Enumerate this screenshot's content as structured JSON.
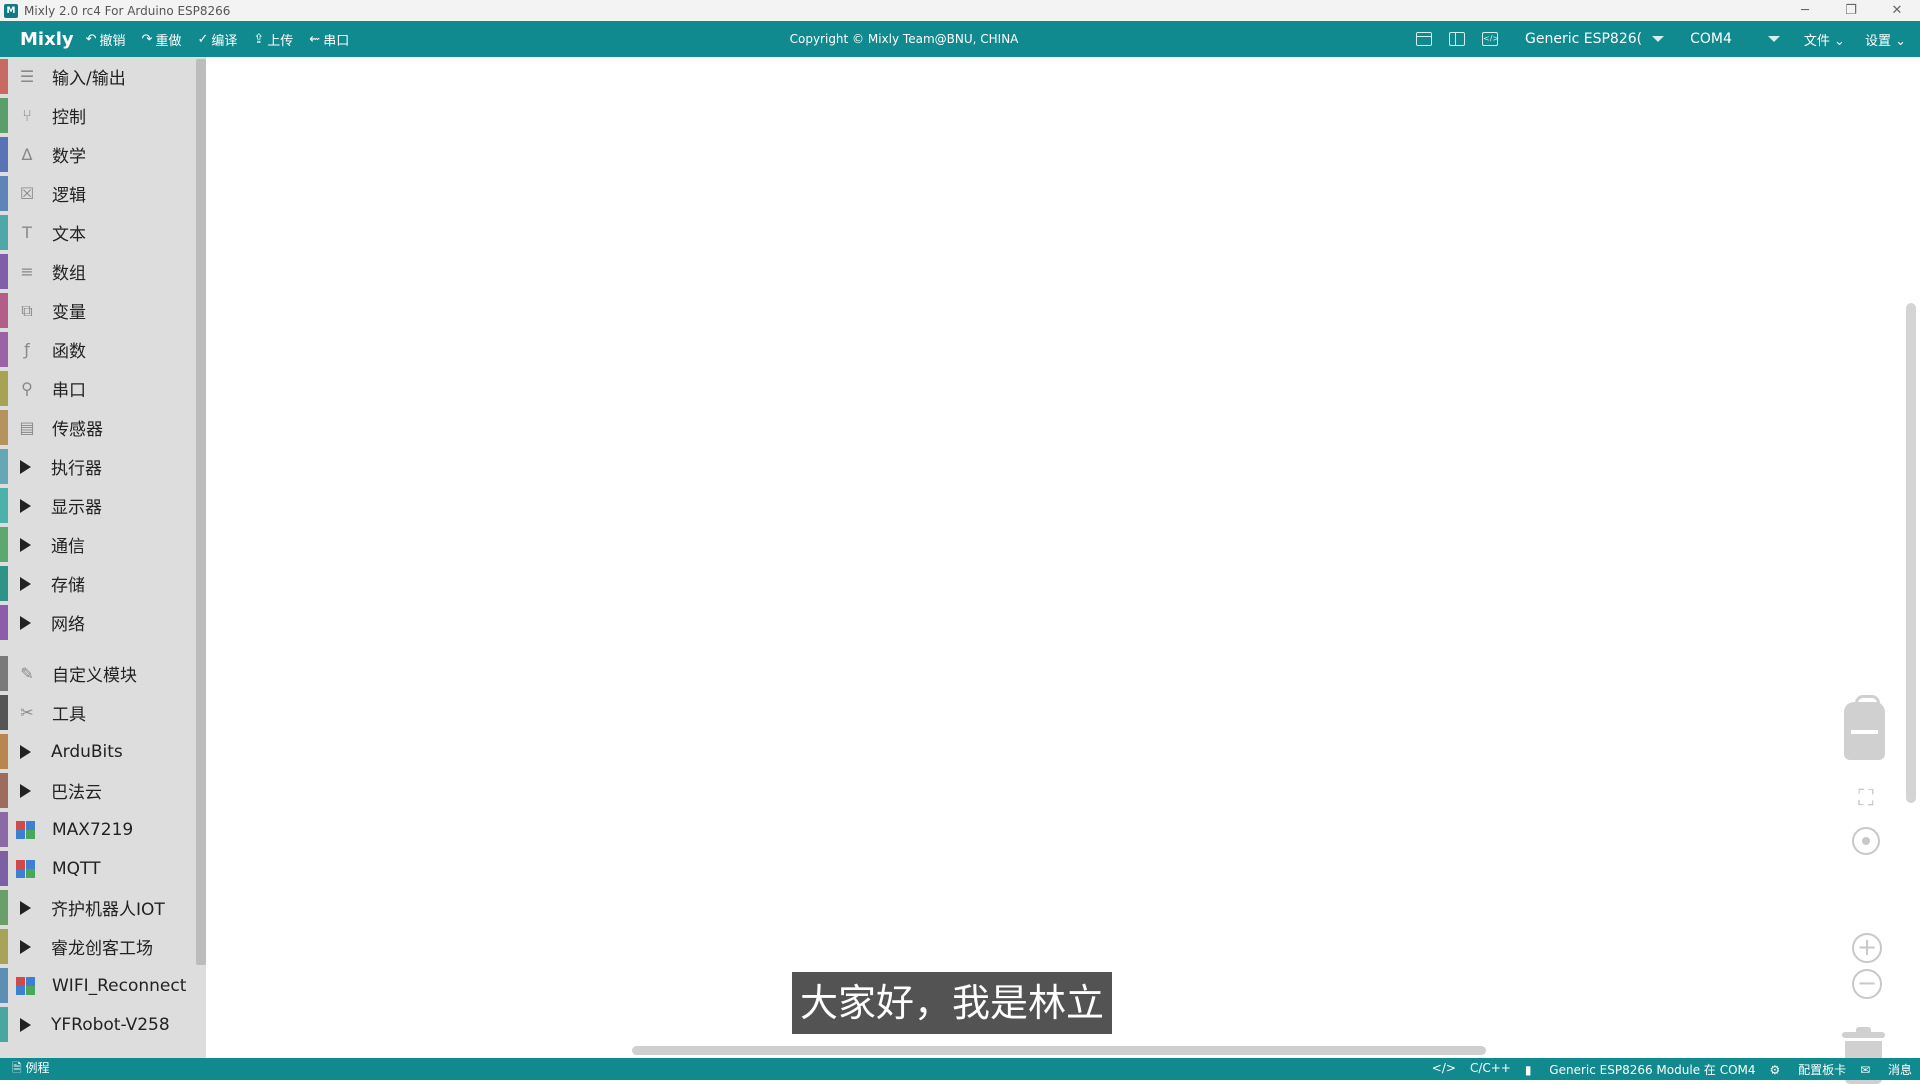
{
  "window": {
    "title": "Mixly 2.0 rc4 For Arduino ESP8266",
    "app_icon_text": "M",
    "minimize": "─",
    "restore": "❐",
    "close": "✕"
  },
  "toolbar": {
    "brand": "Mixly",
    "undo": "撤销",
    "redo": "重做",
    "compile": "编译",
    "upload": "上传",
    "serial": "串口",
    "copyright": "Copyright © Mixly Team@BNU, CHINA",
    "board": "Generic ESP826(",
    "port": "COM4",
    "file_menu": "文件",
    "settings_menu": "设置"
  },
  "sidebar": {
    "categories": [
      {
        "label": "输入/输出",
        "color": "#c76b62",
        "icon": "☰",
        "kind": "icon"
      },
      {
        "label": "控制",
        "color": "#5c9e6b",
        "icon": "⑂",
        "kind": "icon"
      },
      {
        "label": "数学",
        "color": "#5a73b5",
        "icon": "∆",
        "kind": "icon"
      },
      {
        "label": "逻辑",
        "color": "#5f84b8",
        "icon": "☒",
        "kind": "icon"
      },
      {
        "label": "文本",
        "color": "#4fa7a8",
        "icon": "T",
        "kind": "icon"
      },
      {
        "label": "数组",
        "color": "#7f5fa8",
        "icon": "≡",
        "kind": "icon"
      },
      {
        "label": "变量",
        "color": "#b35e88",
        "icon": "⧉",
        "kind": "icon"
      },
      {
        "label": "函数",
        "color": "#9b62a6",
        "icon": "ƒ",
        "kind": "icon"
      },
      {
        "label": "串口",
        "color": "#a8a254",
        "icon": "⚲",
        "kind": "icon"
      },
      {
        "label": "传感器",
        "color": "#b5935f",
        "icon": "▤",
        "kind": "icon"
      },
      {
        "label": "执行器",
        "color": "#67a6b5",
        "kind": "arrow"
      },
      {
        "label": "显示器",
        "color": "#4bb1ab",
        "kind": "arrow"
      },
      {
        "label": "通信",
        "color": "#5da770",
        "kind": "arrow"
      },
      {
        "label": "存储",
        "color": "#2f9486",
        "kind": "arrow"
      },
      {
        "label": "网络",
        "color": "#8c5da8",
        "kind": "arrow"
      },
      {
        "label": "",
        "kind": "separator"
      },
      {
        "label": "自定义模块",
        "color": "#7a7a7a",
        "icon": "✎",
        "kind": "icon"
      },
      {
        "label": "工具",
        "color": "#555555",
        "icon": "✂",
        "kind": "icon"
      },
      {
        "label": "ArduBits",
        "color": "#b7874f",
        "kind": "arrow"
      },
      {
        "label": "巴法云",
        "color": "#9e6c5e",
        "kind": "arrow"
      },
      {
        "label": "MAX7219",
        "color": "#8c6aa6",
        "kind": "blocks"
      },
      {
        "label": "MQTT",
        "color": "#7d5fa3",
        "kind": "blocks"
      },
      {
        "label": "齐护机器人IOT",
        "color": "#6a9e6b",
        "kind": "arrow"
      },
      {
        "label": "睿龙创客工场",
        "color": "#a7a35a",
        "kind": "arrow"
      },
      {
        "label": "WIFI_Reconnect",
        "color": "#5d8fb5",
        "kind": "blocks"
      },
      {
        "label": "YFRobot-V258",
        "color": "#4aa6a0",
        "kind": "arrow"
      }
    ]
  },
  "subtitle": "大家好，我是林立",
  "statusbar": {
    "examples": "例程",
    "language": "C/C++",
    "board_status": "Generic ESP8266 Module 在 COM4",
    "board_config": "配置板卡",
    "messages": "消息"
  },
  "colors": {
    "accent": "#10898f",
    "sidebar_bg": "#dddddd",
    "workspace_bg": "#ffffff"
  }
}
